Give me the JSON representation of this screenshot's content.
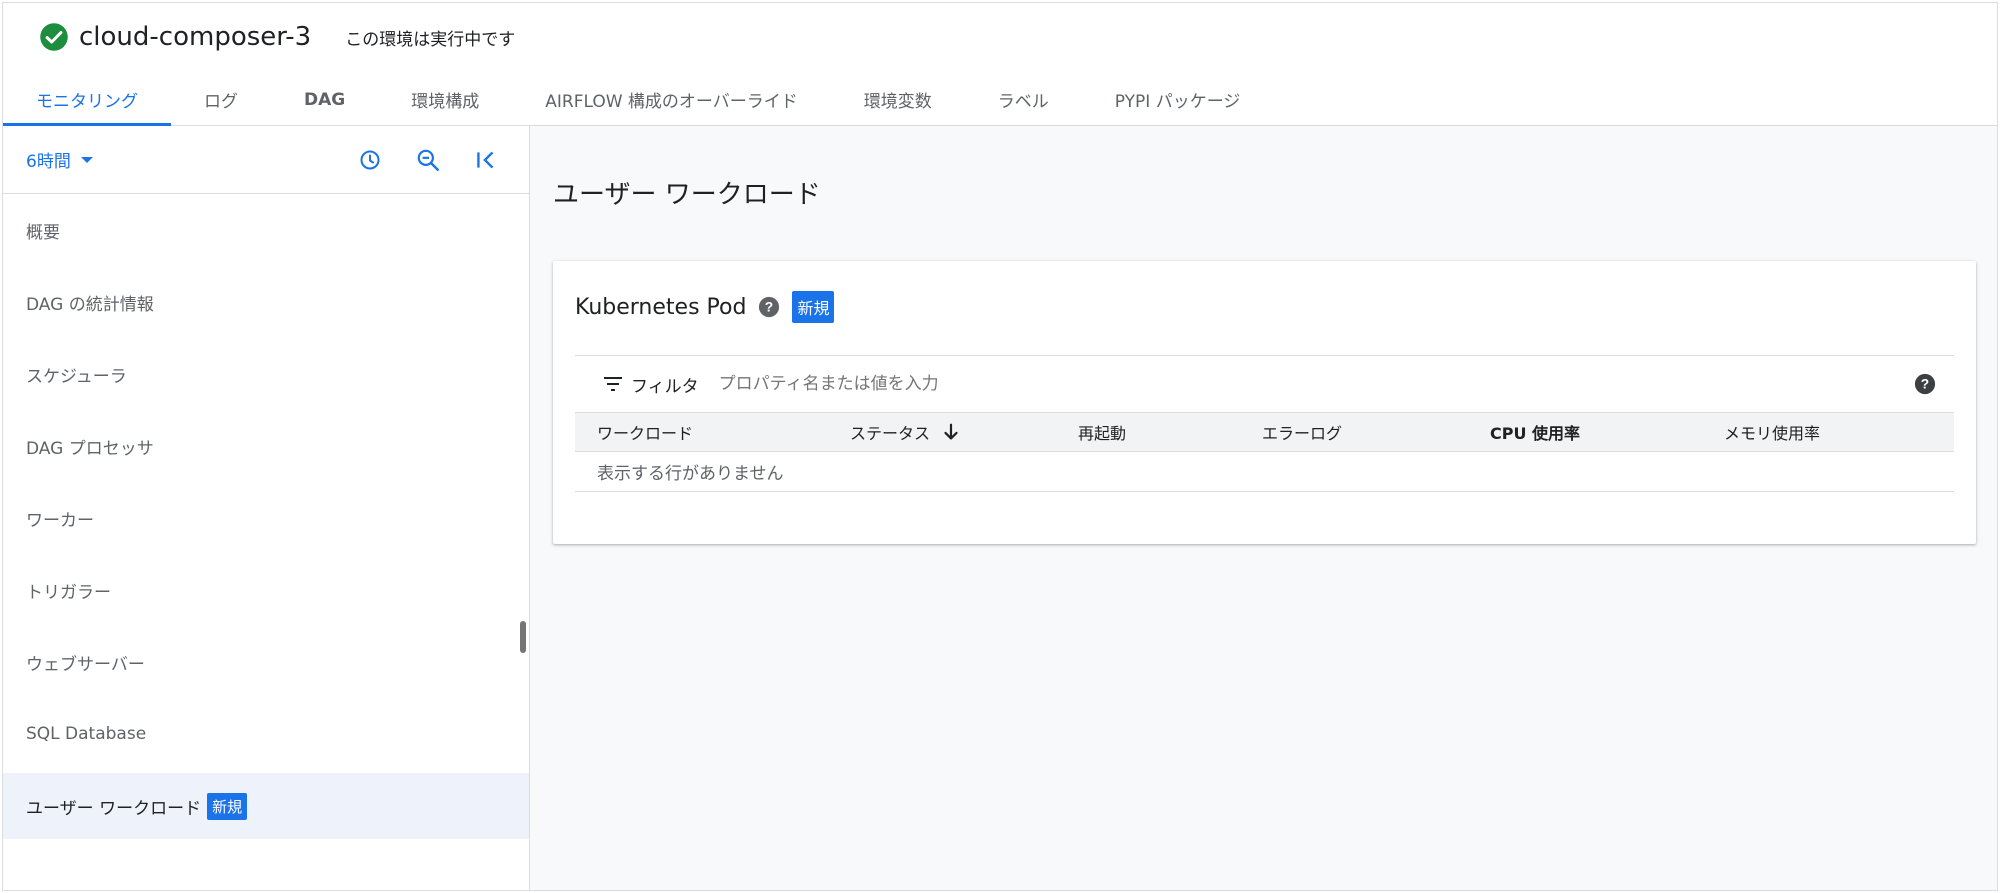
{
  "header": {
    "environment_name": "cloud-composer-3",
    "status_text": "この環境は実行中です",
    "status_icon": "check-circle-icon",
    "status_color": "#1e8e3e"
  },
  "tabs": [
    {
      "label": "モニタリング",
      "active": true
    },
    {
      "label": "ログ"
    },
    {
      "label": "DAG"
    },
    {
      "label": "環境構成"
    },
    {
      "label": "AIRFLOW 構成のオーバーライド"
    },
    {
      "label": "環境変数"
    },
    {
      "label": "ラベル"
    },
    {
      "label": "PYPI パッケージ"
    }
  ],
  "sidebar": {
    "time_range": "6時間",
    "tools": [
      "clock-icon",
      "zoom-out-icon",
      "collapse-left-icon"
    ],
    "items": [
      {
        "label": "概要"
      },
      {
        "label": "DAG の統計情報"
      },
      {
        "label": "スケジューラ"
      },
      {
        "label": "DAG プロセッサ"
      },
      {
        "label": "ワーカー"
      },
      {
        "label": "トリガラー"
      },
      {
        "label": "ウェブサーバー"
      },
      {
        "label": "SQL Database"
      },
      {
        "label": "ユーザー ワークロード",
        "badge": "新規",
        "selected": true
      }
    ]
  },
  "main": {
    "title": "ユーザー ワークロード",
    "card": {
      "title": "Kubernetes Pod",
      "badge": "新規",
      "filter_label": "フィルタ",
      "filter_placeholder": "プロパティ名または値を入力",
      "columns": [
        "ワークロード",
        "ステータス",
        "再起動",
        "エラーログ",
        "CPU 使用率",
        "メモリ使用率"
      ],
      "empty_text": "表示する行がありません"
    }
  },
  "colors": {
    "accent": "#1a73e8",
    "badge_bg": "#1a73e8",
    "main_bg": "#f8f9fa"
  }
}
